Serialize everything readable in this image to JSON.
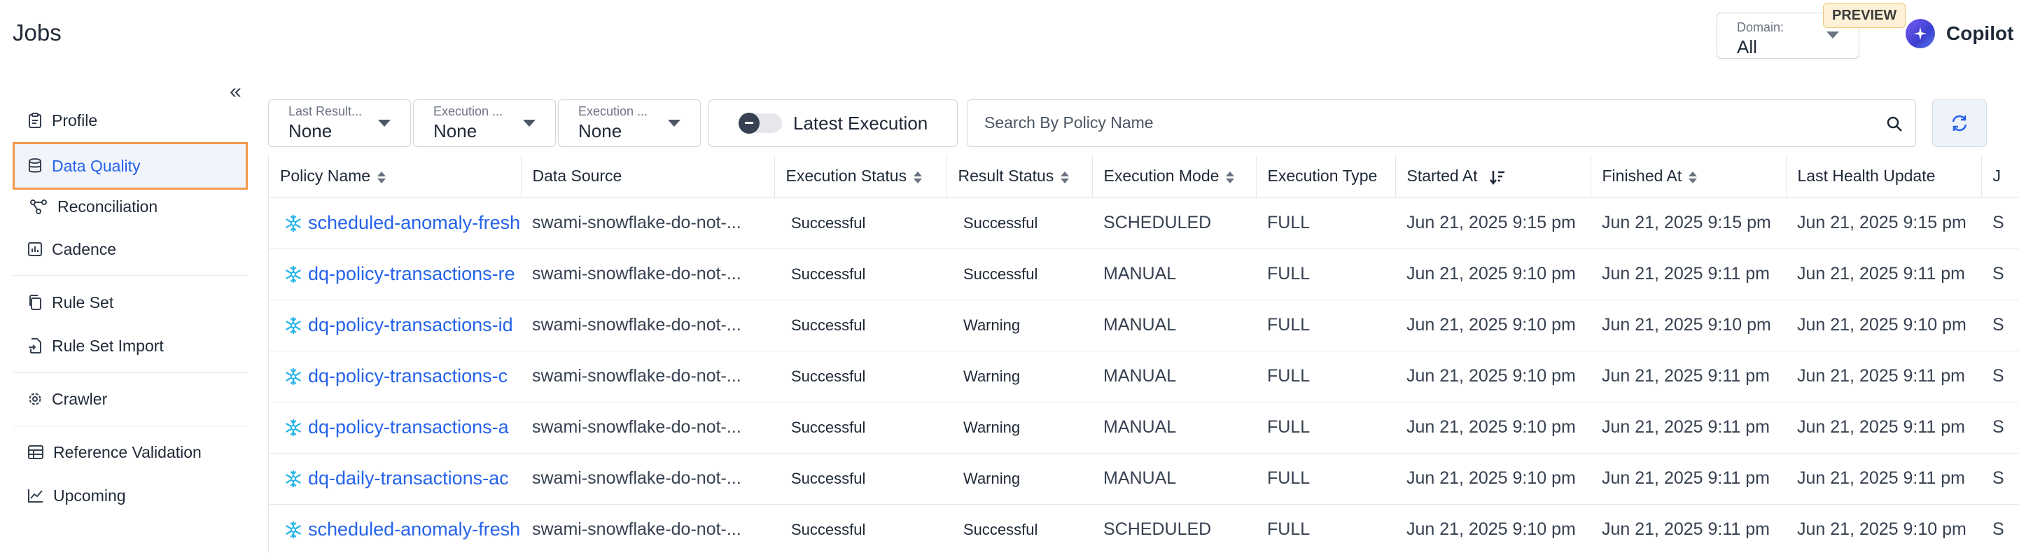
{
  "page_title": "Jobs",
  "domain_filter": {
    "label": "Domain:",
    "value": "All"
  },
  "preview_badge": "PREVIEW",
  "copilot_label": "Copilot",
  "sidebar": {
    "items": [
      {
        "label": "Profile",
        "icon": "clipboard-icon"
      },
      {
        "label": "Data Quality",
        "icon": "database-icon",
        "active": true
      },
      {
        "label": "Reconciliation",
        "icon": "reconciliation-icon"
      },
      {
        "label": "Cadence",
        "icon": "cadence-icon"
      },
      {
        "label": "Rule Set",
        "icon": "copy-icon"
      },
      {
        "label": "Rule Set Import",
        "icon": "file-import-icon"
      },
      {
        "label": "Crawler",
        "icon": "gear-icon"
      },
      {
        "label": "Reference Validation",
        "icon": "table-icon"
      },
      {
        "label": "Upcoming",
        "icon": "line-chart-icon"
      }
    ]
  },
  "filters": [
    {
      "label": "Last Result...",
      "value": "None"
    },
    {
      "label": "Execution ...",
      "value": "None"
    },
    {
      "label": "Execution ...",
      "value": "None"
    }
  ],
  "latest_execution_toggle": {
    "label": "Latest Execution",
    "on": false
  },
  "search": {
    "placeholder": "Search By Policy Name",
    "value": ""
  },
  "table": {
    "columns": [
      "Policy Name",
      "Data Source",
      "Execution Status",
      "Result Status",
      "Execution Mode",
      "Execution Type",
      "Started At",
      "Finished At",
      "Last Health Update",
      "J"
    ],
    "rows": [
      [
        "scheduled-anomaly-fresh",
        "swami-snowflake-do-not-...",
        "Successful",
        "Successful",
        "SCHEDULED",
        "FULL",
        "Jun 21, 2025 9:15 pm",
        "Jun 21, 2025 9:15 pm",
        "Jun 21, 2025 9:15 pm",
        "S"
      ],
      [
        "dq-policy-transactions-re",
        "swami-snowflake-do-not-...",
        "Successful",
        "Successful",
        "MANUAL",
        "FULL",
        "Jun 21, 2025 9:10 pm",
        "Jun 21, 2025 9:11 pm",
        "Jun 21, 2025 9:11 pm",
        "S"
      ],
      [
        "dq-policy-transactions-id",
        "swami-snowflake-do-not-...",
        "Successful",
        "Warning",
        "MANUAL",
        "FULL",
        "Jun 21, 2025 9:10 pm",
        "Jun 21, 2025 9:10 pm",
        "Jun 21, 2025 9:10 pm",
        "S"
      ],
      [
        "dq-policy-transactions-c",
        "swami-snowflake-do-not-...",
        "Successful",
        "Warning",
        "MANUAL",
        "FULL",
        "Jun 21, 2025 9:10 pm",
        "Jun 21, 2025 9:11 pm",
        "Jun 21, 2025 9:11 pm",
        "S"
      ],
      [
        "dq-policy-transactions-a",
        "swami-snowflake-do-not-...",
        "Successful",
        "Warning",
        "MANUAL",
        "FULL",
        "Jun 21, 2025 9:10 pm",
        "Jun 21, 2025 9:11 pm",
        "Jun 21, 2025 9:11 pm",
        "S"
      ],
      [
        "dq-daily-transactions-ac",
        "swami-snowflake-do-not-...",
        "Successful",
        "Warning",
        "MANUAL",
        "FULL",
        "Jun 21, 2025 9:10 pm",
        "Jun 21, 2025 9:11 pm",
        "Jun 21, 2025 9:11 pm",
        "S"
      ],
      [
        "scheduled-anomaly-fresh",
        "swami-snowflake-do-not-...",
        "Successful",
        "Successful",
        "SCHEDULED",
        "FULL",
        "Jun 21, 2025 9:10 pm",
        "Jun 21, 2025 9:11 pm",
        "Jun 21, 2025 9:10 pm",
        "S"
      ]
    ]
  },
  "colors": {
    "accent": "#2563eb",
    "active_outline": "#f2994a",
    "preview_bg": "#fdf2d8"
  }
}
